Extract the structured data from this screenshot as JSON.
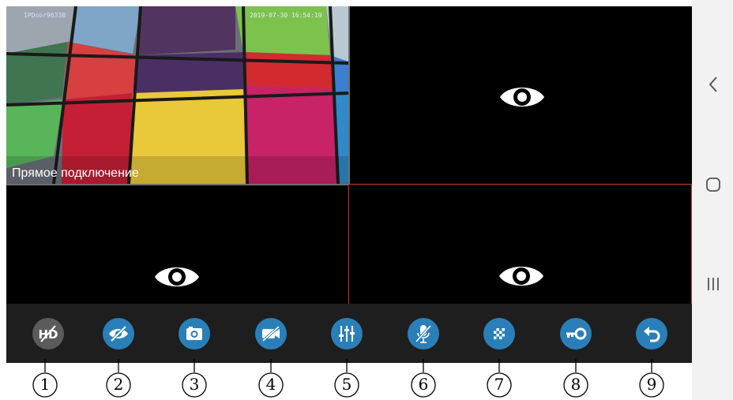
{
  "camera_feed": {
    "device_id": "IPDoor96338",
    "timestamp": "2019-07-30 16:54:19",
    "status": "Прямое подключение"
  },
  "toolbar": {
    "buttons": [
      {
        "icon": "hd-off-icon",
        "color": "#5b5b5b"
      },
      {
        "icon": "eye-off-icon",
        "color": "#2a7fb9"
      },
      {
        "icon": "camera-icon",
        "color": "#2a7fb9"
      },
      {
        "icon": "video-off-icon",
        "color": "#2a7fb9"
      },
      {
        "icon": "equalizer-icon",
        "color": "#2a7fb9"
      },
      {
        "icon": "mic-off-icon",
        "color": "#2a7fb9"
      },
      {
        "icon": "mosaic-icon",
        "color": "#2a7fb9"
      },
      {
        "icon": "key-icon",
        "color": "#2a7fb9"
      },
      {
        "icon": "back-icon",
        "color": "#2a7fb9"
      }
    ]
  },
  "callouts": [
    "1",
    "2",
    "3",
    "4",
    "5",
    "6",
    "7",
    "8",
    "9"
  ],
  "colors": {
    "accent": "#2a7fb9",
    "selected_border": "#c0392b"
  }
}
